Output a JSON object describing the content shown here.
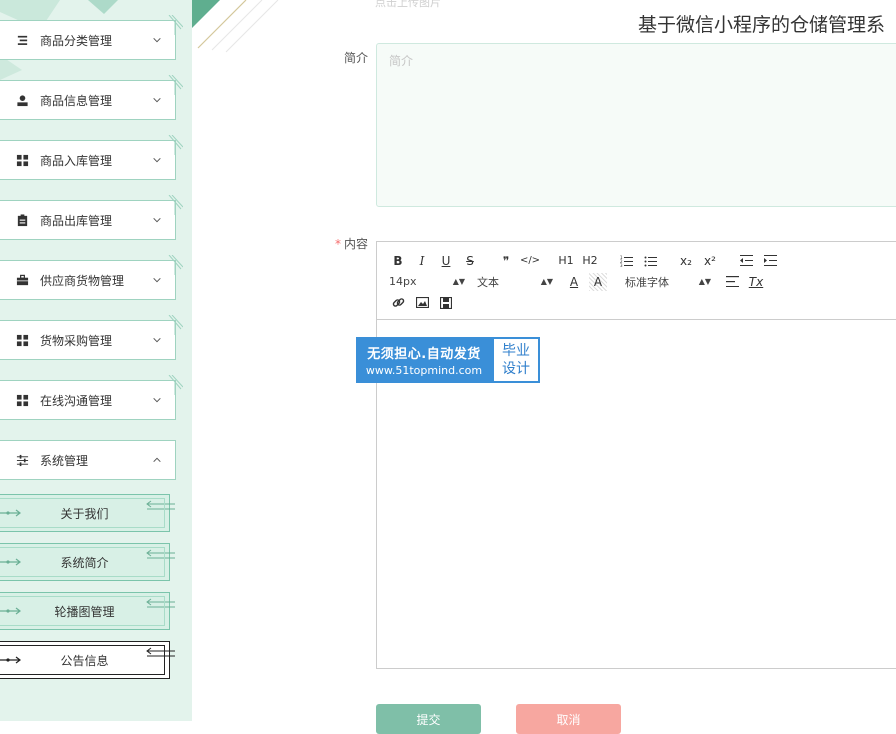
{
  "page": {
    "title": "基于微信小程序的仓储管理系",
    "upload_hint": "点击上传图片"
  },
  "sidebar": {
    "menus": [
      {
        "label": "商品分类管理",
        "icon": "list-icon",
        "expanded": false
      },
      {
        "label": "商品信息管理",
        "icon": "user-icon",
        "expanded": false
      },
      {
        "label": "商品入库管理",
        "icon": "grid-icon",
        "expanded": false
      },
      {
        "label": "商品出库管理",
        "icon": "clipboard-icon",
        "expanded": false
      },
      {
        "label": "供应商货物管理",
        "icon": "briefcase-icon",
        "expanded": false
      },
      {
        "label": "货物采购管理",
        "icon": "grid-icon",
        "expanded": false
      },
      {
        "label": "在线沟通管理",
        "icon": "grid-icon",
        "expanded": false
      },
      {
        "label": "系统管理",
        "icon": "sliders-icon",
        "expanded": true
      }
    ],
    "submenu": [
      {
        "label": "关于我们",
        "active": false
      },
      {
        "label": "系统简介",
        "active": false
      },
      {
        "label": "轮播图管理",
        "active": false
      },
      {
        "label": "公告信息",
        "active": true
      }
    ]
  },
  "form": {
    "intro": {
      "label": "简介",
      "placeholder": "简介",
      "value": ""
    },
    "content": {
      "label": "内容",
      "required_mark": "*"
    }
  },
  "editor": {
    "font_size": "14px",
    "paragraph": "文本",
    "font_family": "标准字体",
    "buttons": {
      "bold": "B",
      "italic": "I",
      "underline": "U",
      "strike": "S",
      "quote": "❞",
      "code": "</>",
      "h1": "H1",
      "h2": "H2",
      "sub": "x₂",
      "sup": "x²",
      "color": "A",
      "bg": "A",
      "clean": "Tx"
    }
  },
  "watermark": {
    "line1": "无须担心.自动发货",
    "line2": "www.51topmind.com",
    "side1": "毕业",
    "side2": "设计"
  },
  "buttons": {
    "submit": "提交",
    "cancel": "取消"
  },
  "colors": {
    "sidebar_bg": "#e3f3ec",
    "accent": "#7fbfa8",
    "cancel": "#f7a7a0",
    "required": "#f56c6c",
    "watermark_blue": "#3a8fd8"
  }
}
